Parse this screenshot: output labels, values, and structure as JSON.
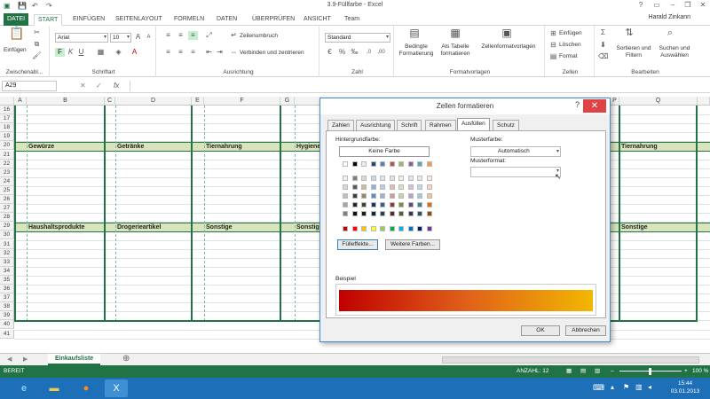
{
  "window": {
    "title": "3.9-Füllfarbe - Excel",
    "user": "Harald Zinkann"
  },
  "ribbon_tabs": [
    "DATEI",
    "START",
    "EINFÜGEN",
    "SEITENLAYOUT",
    "FORMELN",
    "DATEN",
    "ÜBERPRÜFEN",
    "ANSICHT",
    "Team"
  ],
  "ribbon": {
    "clipboard": {
      "paste": "Einfügen",
      "label": "Zwischenabl..."
    },
    "font": {
      "name": "Arial",
      "size": "10",
      "label": "Schriftart"
    },
    "alignment": {
      "wrap": "Zeilenumbruch",
      "merge": "Verbinden und zentrieren",
      "label": "Ausrichtung"
    },
    "number": {
      "format": "Standard",
      "label": "Zahl"
    },
    "styles": {
      "cond": "Bedingte Formatierung",
      "table": "Als Tabelle formatieren",
      "cellstyles": "Zellenformatvorlagen",
      "label": "Formatvorlagen"
    },
    "cells": {
      "insert": "Einfügen",
      "delete": "Löschen",
      "format": "Format",
      "label": "Zellen"
    },
    "editing": {
      "sort": "Sortieren und Filtern",
      "find": "Suchen und Auswählen",
      "label": "Bearbeiten"
    }
  },
  "formula": {
    "namebox": "A29",
    "fx": "fx"
  },
  "columns": [
    "A",
    "B",
    "C",
    "D",
    "E",
    "F",
    "G",
    "P",
    "Q"
  ],
  "rows": [
    "16",
    "17",
    "18",
    "19",
    "20",
    "21",
    "22",
    "23",
    "24",
    "25",
    "26",
    "27",
    "28",
    "29",
    "30",
    "31",
    "32",
    "33",
    "34",
    "35",
    "36",
    "37",
    "38",
    "39",
    "40",
    "41"
  ],
  "row20": [
    "Gewürze",
    "Getränke",
    "Tiernahrung",
    "Hygiene",
    "Tiernahrung"
  ],
  "row29": [
    "Haushaltsprodukte",
    "Drogerieartikel",
    "Sonstige",
    "Sonstig",
    "Sonstige"
  ],
  "dialog": {
    "title": "Zellen formatieren",
    "help": "?",
    "tabs": [
      "Zahlen",
      "Ausrichtung",
      "Schrift",
      "Rahmen",
      "Ausfüllen",
      "Schutz"
    ],
    "bg_label": "Hintergrundfarbe:",
    "no_color": "Keine Farbe",
    "fill_effects": "Fülleffekte...",
    "more_colors": "Weitere Farben...",
    "pattern_color_label": "Musterfarbe:",
    "pattern_color_value": "Automatisch",
    "pattern_style_label": "Musterformat:",
    "sample_label": "Beispiel",
    "ok": "OK",
    "cancel": "Abbrechen"
  },
  "sheet": {
    "tab": "Einkaufsliste"
  },
  "status": {
    "mode": "BEREIT",
    "count": "ANZAHL: 12",
    "zoom": "100 %"
  },
  "taskbar": {
    "time": "15:44",
    "date": "03.01.2013"
  },
  "colors": {
    "accent": "#217346",
    "header_fill": "#d8e4bc",
    "taskbar": "#1d6fb8"
  }
}
